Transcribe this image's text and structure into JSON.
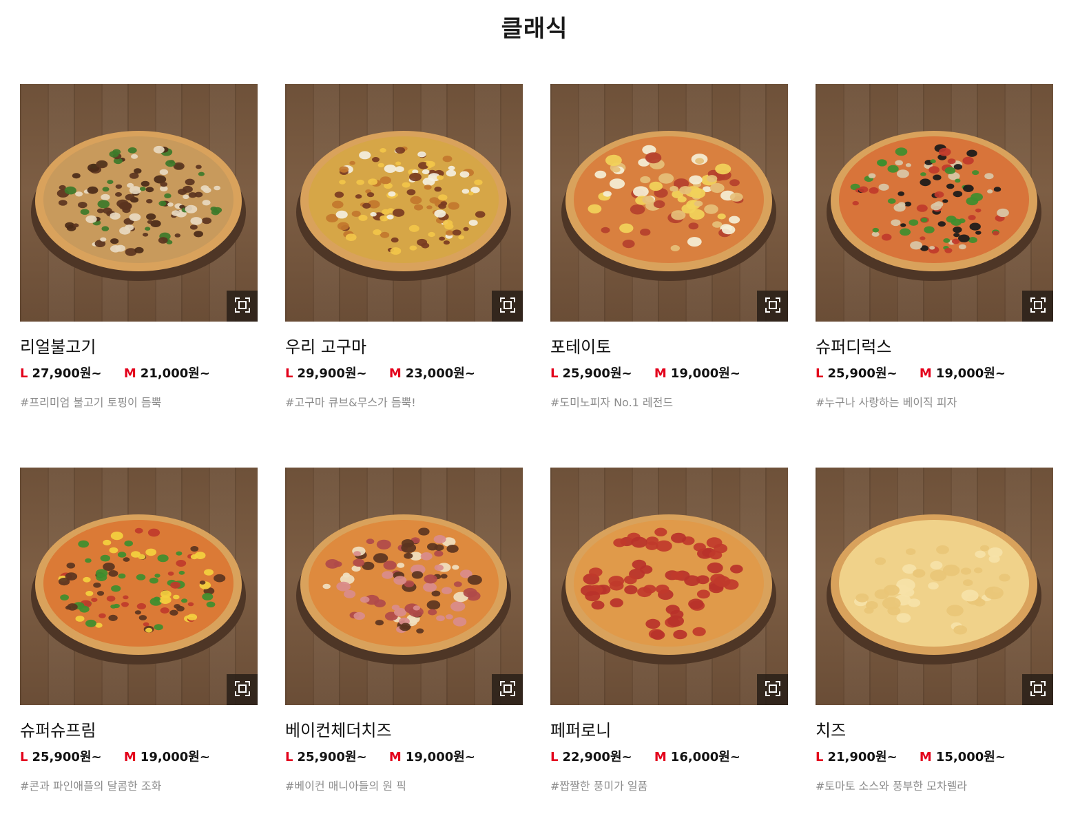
{
  "section": {
    "title": "클래식"
  },
  "colors": {
    "size_label": "#e3001b",
    "tag_text": "#8c8c8c"
  },
  "icons": {
    "zoom": "zoom-expand-icon"
  },
  "products": [
    {
      "name": "리얼불고기",
      "l_label": "L",
      "l_price": "27,900원~",
      "m_label": "M",
      "m_price": "21,000원~",
      "tag": "#프리미엄 불고기 토핑이 듬뿍",
      "topping": "bulgogi"
    },
    {
      "name": "우리 고구마",
      "l_label": "L",
      "l_price": "29,900원~",
      "m_label": "M",
      "m_price": "23,000원~",
      "tag": "#고구마 큐브&무스가 듬뿍!",
      "topping": "sweetpotato"
    },
    {
      "name": "포테이토",
      "l_label": "L",
      "l_price": "25,900원~",
      "m_label": "M",
      "m_price": "19,000원~",
      "tag": "#도미노피자 No.1 레전드",
      "topping": "potato"
    },
    {
      "name": "슈퍼디럭스",
      "l_label": "L",
      "l_price": "25,900원~",
      "m_label": "M",
      "m_price": "19,000원~",
      "tag": "#누구나 사랑하는 베이직 피자",
      "topping": "deluxe"
    },
    {
      "name": "슈퍼슈프림",
      "l_label": "L",
      "l_price": "25,900원~",
      "m_label": "M",
      "m_price": "19,000원~",
      "tag": "#콘과 파인애플의 달콤한 조화",
      "topping": "supreme"
    },
    {
      "name": "베이컨체더치즈",
      "l_label": "L",
      "l_price": "25,900원~",
      "m_label": "M",
      "m_price": "19,000원~",
      "tag": "#베이컨 매니아들의 원 픽",
      "topping": "bacon"
    },
    {
      "name": "페퍼로니",
      "l_label": "L",
      "l_price": "22,900원~",
      "m_label": "M",
      "m_price": "16,000원~",
      "tag": "#짭짤한 풍미가 일품",
      "topping": "pepperoni"
    },
    {
      "name": "치즈",
      "l_label": "L",
      "l_price": "21,900원~",
      "m_label": "M",
      "m_price": "15,000원~",
      "tag": "#토마토 소스와 풍부한 모차렐라",
      "topping": "cheese"
    }
  ]
}
